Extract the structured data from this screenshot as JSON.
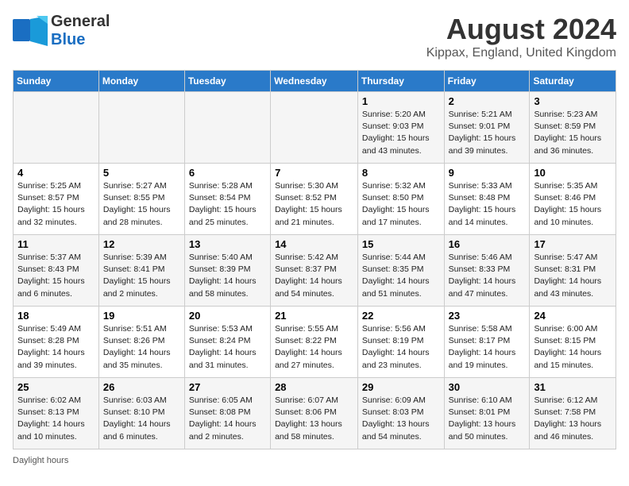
{
  "header": {
    "logo_line1": "General",
    "logo_line2": "Blue",
    "month_title": "August 2024",
    "location": "Kippax, England, United Kingdom"
  },
  "days_of_week": [
    "Sunday",
    "Monday",
    "Tuesday",
    "Wednesday",
    "Thursday",
    "Friday",
    "Saturday"
  ],
  "weeks": [
    [
      {
        "day": "",
        "info": ""
      },
      {
        "day": "",
        "info": ""
      },
      {
        "day": "",
        "info": ""
      },
      {
        "day": "",
        "info": ""
      },
      {
        "day": "1",
        "info": "Sunrise: 5:20 AM\nSunset: 9:03 PM\nDaylight: 15 hours and 43 minutes."
      },
      {
        "day": "2",
        "info": "Sunrise: 5:21 AM\nSunset: 9:01 PM\nDaylight: 15 hours and 39 minutes."
      },
      {
        "day": "3",
        "info": "Sunrise: 5:23 AM\nSunset: 8:59 PM\nDaylight: 15 hours and 36 minutes."
      }
    ],
    [
      {
        "day": "4",
        "info": "Sunrise: 5:25 AM\nSunset: 8:57 PM\nDaylight: 15 hours and 32 minutes."
      },
      {
        "day": "5",
        "info": "Sunrise: 5:27 AM\nSunset: 8:55 PM\nDaylight: 15 hours and 28 minutes."
      },
      {
        "day": "6",
        "info": "Sunrise: 5:28 AM\nSunset: 8:54 PM\nDaylight: 15 hours and 25 minutes."
      },
      {
        "day": "7",
        "info": "Sunrise: 5:30 AM\nSunset: 8:52 PM\nDaylight: 15 hours and 21 minutes."
      },
      {
        "day": "8",
        "info": "Sunrise: 5:32 AM\nSunset: 8:50 PM\nDaylight: 15 hours and 17 minutes."
      },
      {
        "day": "9",
        "info": "Sunrise: 5:33 AM\nSunset: 8:48 PM\nDaylight: 15 hours and 14 minutes."
      },
      {
        "day": "10",
        "info": "Sunrise: 5:35 AM\nSunset: 8:46 PM\nDaylight: 15 hours and 10 minutes."
      }
    ],
    [
      {
        "day": "11",
        "info": "Sunrise: 5:37 AM\nSunset: 8:43 PM\nDaylight: 15 hours and 6 minutes."
      },
      {
        "day": "12",
        "info": "Sunrise: 5:39 AM\nSunset: 8:41 PM\nDaylight: 15 hours and 2 minutes."
      },
      {
        "day": "13",
        "info": "Sunrise: 5:40 AM\nSunset: 8:39 PM\nDaylight: 14 hours and 58 minutes."
      },
      {
        "day": "14",
        "info": "Sunrise: 5:42 AM\nSunset: 8:37 PM\nDaylight: 14 hours and 54 minutes."
      },
      {
        "day": "15",
        "info": "Sunrise: 5:44 AM\nSunset: 8:35 PM\nDaylight: 14 hours and 51 minutes."
      },
      {
        "day": "16",
        "info": "Sunrise: 5:46 AM\nSunset: 8:33 PM\nDaylight: 14 hours and 47 minutes."
      },
      {
        "day": "17",
        "info": "Sunrise: 5:47 AM\nSunset: 8:31 PM\nDaylight: 14 hours and 43 minutes."
      }
    ],
    [
      {
        "day": "18",
        "info": "Sunrise: 5:49 AM\nSunset: 8:28 PM\nDaylight: 14 hours and 39 minutes."
      },
      {
        "day": "19",
        "info": "Sunrise: 5:51 AM\nSunset: 8:26 PM\nDaylight: 14 hours and 35 minutes."
      },
      {
        "day": "20",
        "info": "Sunrise: 5:53 AM\nSunset: 8:24 PM\nDaylight: 14 hours and 31 minutes."
      },
      {
        "day": "21",
        "info": "Sunrise: 5:55 AM\nSunset: 8:22 PM\nDaylight: 14 hours and 27 minutes."
      },
      {
        "day": "22",
        "info": "Sunrise: 5:56 AM\nSunset: 8:19 PM\nDaylight: 14 hours and 23 minutes."
      },
      {
        "day": "23",
        "info": "Sunrise: 5:58 AM\nSunset: 8:17 PM\nDaylight: 14 hours and 19 minutes."
      },
      {
        "day": "24",
        "info": "Sunrise: 6:00 AM\nSunset: 8:15 PM\nDaylight: 14 hours and 15 minutes."
      }
    ],
    [
      {
        "day": "25",
        "info": "Sunrise: 6:02 AM\nSunset: 8:13 PM\nDaylight: 14 hours and 10 minutes."
      },
      {
        "day": "26",
        "info": "Sunrise: 6:03 AM\nSunset: 8:10 PM\nDaylight: 14 hours and 6 minutes."
      },
      {
        "day": "27",
        "info": "Sunrise: 6:05 AM\nSunset: 8:08 PM\nDaylight: 14 hours and 2 minutes."
      },
      {
        "day": "28",
        "info": "Sunrise: 6:07 AM\nSunset: 8:06 PM\nDaylight: 13 hours and 58 minutes."
      },
      {
        "day": "29",
        "info": "Sunrise: 6:09 AM\nSunset: 8:03 PM\nDaylight: 13 hours and 54 minutes."
      },
      {
        "day": "30",
        "info": "Sunrise: 6:10 AM\nSunset: 8:01 PM\nDaylight: 13 hours and 50 minutes."
      },
      {
        "day": "31",
        "info": "Sunrise: 6:12 AM\nSunset: 7:58 PM\nDaylight: 13 hours and 46 minutes."
      }
    ]
  ],
  "footer": {
    "note": "Daylight hours"
  }
}
